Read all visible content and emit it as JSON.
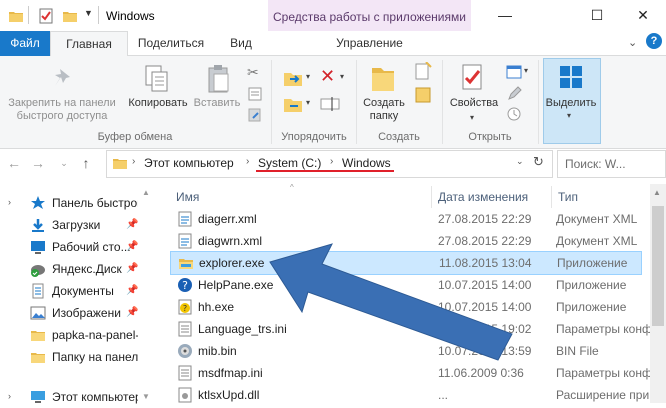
{
  "window": {
    "title": "Windows",
    "manage_context": "Средства работы с приложениями",
    "minimize": "—",
    "maximize": "☐",
    "close": "✕"
  },
  "tabs": {
    "file": "Файл",
    "home": "Главная",
    "share": "Поделиться",
    "view": "Вид",
    "manage": "Управление"
  },
  "ribbon": {
    "pin_label": "Закрепить на панели быстрого доступа",
    "copy_label": "Копировать",
    "paste_label": "Вставить",
    "clipboard_group": "Буфер обмена",
    "organize_group": "Упорядочить",
    "new_folder_label": "Создать папку",
    "create_group": "Создать",
    "properties_label": "Свойства",
    "open_group": "Открыть",
    "select_label": "Выделить"
  },
  "address": {
    "segments": [
      "Этот компьютер",
      "System (C:)",
      "Windows"
    ],
    "search_placeholder": "Поиск: W..."
  },
  "nav": {
    "items": [
      {
        "label": "Панель быстрого",
        "pinned": false
      },
      {
        "label": "Загрузки",
        "pinned": true
      },
      {
        "label": "Рабочий сто...",
        "pinned": true
      },
      {
        "label": "Яндекс.Диск",
        "pinned": true
      },
      {
        "label": "Документы",
        "pinned": true
      },
      {
        "label": "Изображени",
        "pinned": true
      },
      {
        "label": "papka-na-panel-",
        "pinned": false
      },
      {
        "label": "Папку на панел",
        "pinned": false
      },
      {
        "label": "Этот компьютер",
        "pinned": false
      }
    ]
  },
  "columns": {
    "name": "Имя",
    "date": "Дата изменения",
    "type": "Тип"
  },
  "files": [
    {
      "name": "diagerr.xml",
      "date": "27.08.2015 22:29",
      "type": "Документ XML",
      "icon": "xml-file-icon"
    },
    {
      "name": "diagwrn.xml",
      "date": "27.08.2015 22:29",
      "type": "Документ XML",
      "icon": "xml-file-icon"
    },
    {
      "name": "explorer.exe",
      "date": "11.08.2015 13:04",
      "type": "Приложение",
      "icon": "explorer-folder-icon",
      "selected": true
    },
    {
      "name": "HelpPane.exe",
      "date": "10.07.2015 14:00",
      "type": "Приложение",
      "icon": "help-icon"
    },
    {
      "name": "hh.exe",
      "date": "10.07.2015 14:00",
      "type": "Приложение",
      "icon": "help-doc-icon"
    },
    {
      "name": "Language_trs.ini",
      "date": "10.03.2015 19:02",
      "type": "Параметры конф",
      "icon": "ini-file-icon"
    },
    {
      "name": "mib.bin",
      "date": "10.07.2015 13:59",
      "type": "BIN File",
      "icon": "bin-file-icon"
    },
    {
      "name": "msdfmap.ini",
      "date": "11.06.2009 0:36",
      "type": "Параметры конф",
      "icon": "ini-file-icon"
    },
    {
      "name": "ktlsxUpd.dll",
      "date": "...",
      "type": "Расширение при",
      "icon": "dll-file-icon"
    }
  ],
  "colors": {
    "accent": "#1979ca",
    "arrow": "#3a6fb4",
    "underline": "#e0202a"
  }
}
